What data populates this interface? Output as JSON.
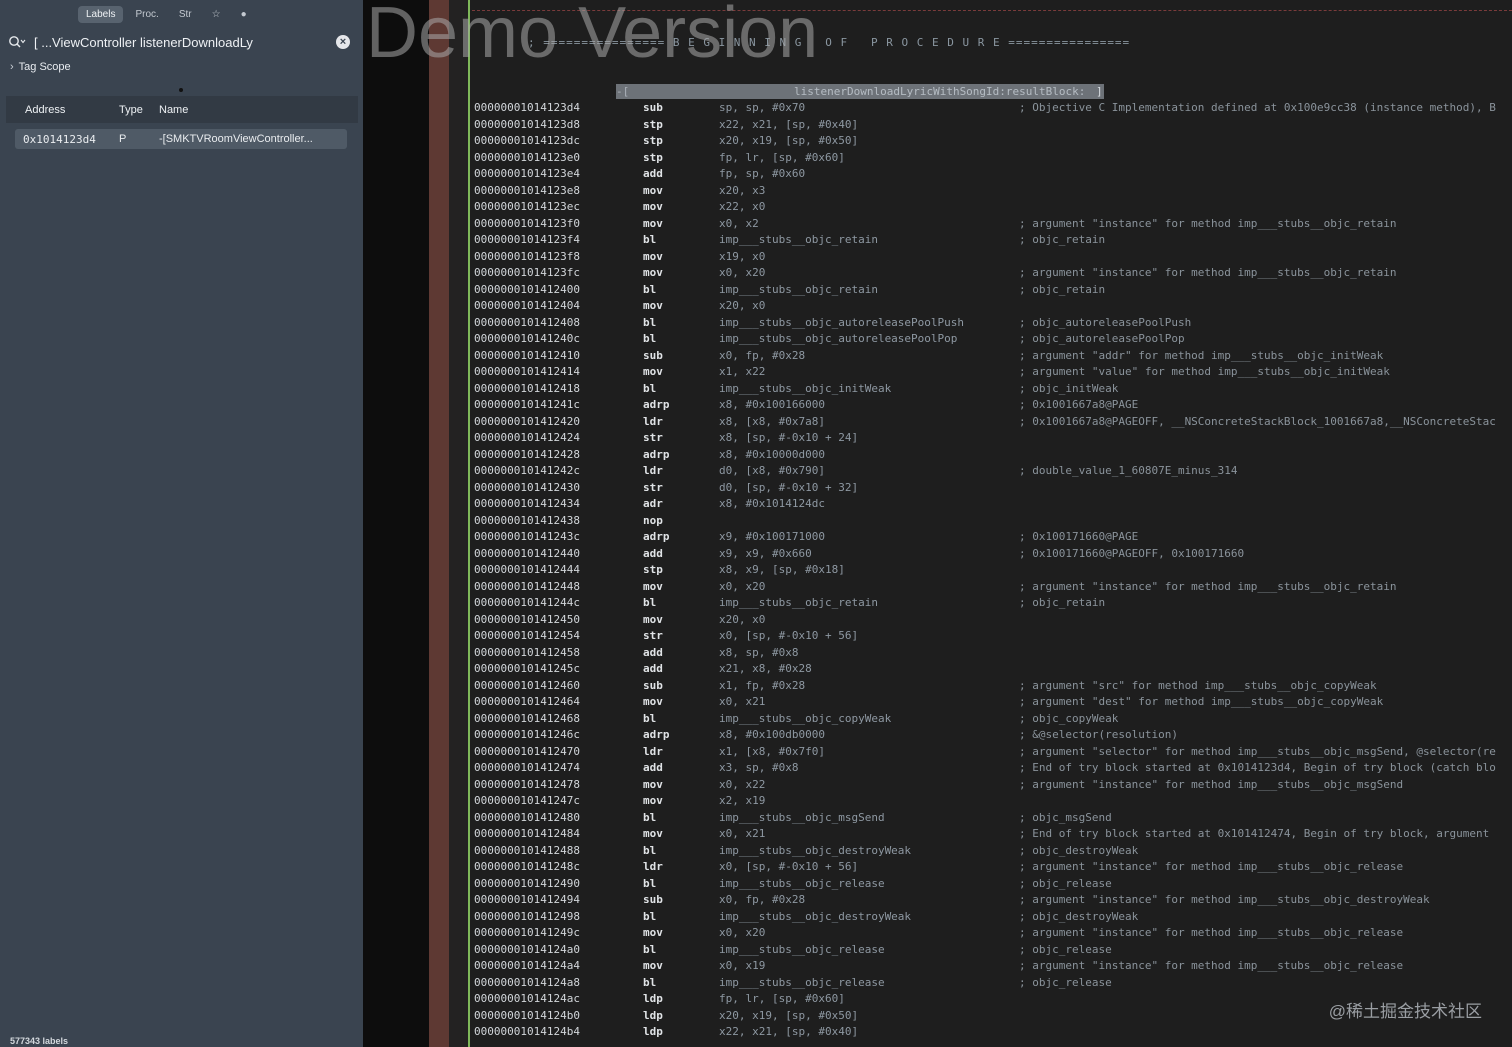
{
  "sidebar": {
    "tabs": [
      "Labels",
      "Proc.",
      "Str",
      "☆",
      "●"
    ],
    "search": {
      "value": "[ ...ViewController listenerDownloadLy"
    },
    "tag_scope": "Tag Scope",
    "columns": {
      "address": "Address",
      "type": "Type",
      "name": "Name"
    },
    "result": {
      "address": "0x1014123d4",
      "type": "P",
      "name": "-[SMKTVRoomViewController..."
    },
    "label_count": "577343 labels"
  },
  "code": {
    "watermark": "Demo Version",
    "banner": "; ================ B E G I N N I N G   O F   P R O C E D U R E ================",
    "procedure_label": "listenerDownloadLyricWithSongId:resultBlock:",
    "procedure_prefix": "-[",
    "procedure_suffix": "]:",
    "lines": [
      {
        "a": "00000001014123d4",
        "m": "sub",
        "o": "sp, sp, #0x70",
        "c": "; Objective C Implementation defined at 0x100e9cc38 (instance method), B"
      },
      {
        "a": "00000001014123d8",
        "m": "stp",
        "o": "x22, x21, [sp, #0x40]",
        "c": ""
      },
      {
        "a": "00000001014123dc",
        "m": "stp",
        "o": "x20, x19, [sp, #0x50]",
        "c": ""
      },
      {
        "a": "00000001014123e0",
        "m": "stp",
        "o": "fp, lr, [sp, #0x60]",
        "c": ""
      },
      {
        "a": "00000001014123e4",
        "m": "add",
        "o": "fp, sp, #0x60",
        "c": ""
      },
      {
        "a": "00000001014123e8",
        "m": "mov",
        "o": "x20, x3",
        "c": ""
      },
      {
        "a": "00000001014123ec",
        "m": "mov",
        "o": "x22, x0",
        "c": ""
      },
      {
        "a": "00000001014123f0",
        "m": "mov",
        "o": "x0, x2",
        "c": "; argument \"instance\" for method imp___stubs__objc_retain"
      },
      {
        "a": "00000001014123f4",
        "m": "bl",
        "o": "imp___stubs__objc_retain",
        "c": "; objc_retain"
      },
      {
        "a": "00000001014123f8",
        "m": "mov",
        "o": "x19, x0",
        "c": ""
      },
      {
        "a": "00000001014123fc",
        "m": "mov",
        "o": "x0, x20",
        "c": "; argument \"instance\" for method imp___stubs__objc_retain"
      },
      {
        "a": "0000000101412400",
        "m": "bl",
        "o": "imp___stubs__objc_retain",
        "c": "; objc_retain"
      },
      {
        "a": "0000000101412404",
        "m": "mov",
        "o": "x20, x0",
        "c": ""
      },
      {
        "a": "0000000101412408",
        "m": "bl",
        "o": "imp___stubs__objc_autoreleasePoolPush",
        "c": "; objc_autoreleasePoolPush"
      },
      {
        "a": "000000010141240c",
        "m": "bl",
        "o": "imp___stubs__objc_autoreleasePoolPop",
        "c": "; objc_autoreleasePoolPop"
      },
      {
        "a": "0000000101412410",
        "m": "sub",
        "o": "x0, fp, #0x28",
        "c": "; argument \"addr\" for method imp___stubs__objc_initWeak"
      },
      {
        "a": "0000000101412414",
        "m": "mov",
        "o": "x1, x22",
        "c": "; argument \"value\" for method imp___stubs__objc_initWeak"
      },
      {
        "a": "0000000101412418",
        "m": "bl",
        "o": "imp___stubs__objc_initWeak",
        "c": "; objc_initWeak"
      },
      {
        "a": "000000010141241c",
        "m": "adrp",
        "o": "x8, #0x100166000",
        "c": "; 0x1001667a8@PAGE"
      },
      {
        "a": "0000000101412420",
        "m": "ldr",
        "o": "x8, [x8, #0x7a8]",
        "c": "; 0x1001667a8@PAGEOFF, __NSConcreteStackBlock_1001667a8,__NSConcreteStac"
      },
      {
        "a": "0000000101412424",
        "m": "str",
        "o": "x8, [sp, #-0x10 + 24]",
        "c": ""
      },
      {
        "a": "0000000101412428",
        "m": "adrp",
        "o": "x8, #0x10000d000",
        "c": ""
      },
      {
        "a": "000000010141242c",
        "m": "ldr",
        "o": "d0, [x8, #0x790]",
        "c": "; double_value_1_60807E_minus_314"
      },
      {
        "a": "0000000101412430",
        "m": "str",
        "o": "d0, [sp, #-0x10 + 32]",
        "c": ""
      },
      {
        "a": "0000000101412434",
        "m": "adr",
        "o": "x8, #0x1014124dc",
        "c": ""
      },
      {
        "a": "0000000101412438",
        "m": "nop",
        "o": "",
        "c": ""
      },
      {
        "a": "000000010141243c",
        "m": "adrp",
        "o": "x9, #0x100171000",
        "c": "; 0x100171660@PAGE"
      },
      {
        "a": "0000000101412440",
        "m": "add",
        "o": "x9, x9, #0x660",
        "c": "; 0x100171660@PAGEOFF, 0x100171660"
      },
      {
        "a": "0000000101412444",
        "m": "stp",
        "o": "x8, x9, [sp, #0x18]",
        "c": ""
      },
      {
        "a": "0000000101412448",
        "m": "mov",
        "o": "x0, x20",
        "c": "; argument \"instance\" for method imp___stubs__objc_retain"
      },
      {
        "a": "000000010141244c",
        "m": "bl",
        "o": "imp___stubs__objc_retain",
        "c": "; objc_retain"
      },
      {
        "a": "0000000101412450",
        "m": "mov",
        "o": "x20, x0",
        "c": ""
      },
      {
        "a": "0000000101412454",
        "m": "str",
        "o": "x0, [sp, #-0x10 + 56]",
        "c": ""
      },
      {
        "a": "0000000101412458",
        "m": "add",
        "o": "x8, sp, #0x8",
        "c": ""
      },
      {
        "a": "000000010141245c",
        "m": "add",
        "o": "x21, x8, #0x28",
        "c": ""
      },
      {
        "a": "0000000101412460",
        "m": "sub",
        "o": "x1, fp, #0x28",
        "c": "; argument \"src\" for method imp___stubs__objc_copyWeak"
      },
      {
        "a": "0000000101412464",
        "m": "mov",
        "o": "x0, x21",
        "c": "; argument \"dest\" for method imp___stubs__objc_copyWeak"
      },
      {
        "a": "0000000101412468",
        "m": "bl",
        "o": "imp___stubs__objc_copyWeak",
        "c": "; objc_copyWeak"
      },
      {
        "a": "000000010141246c",
        "m": "adrp",
        "o": "x8, #0x100db0000",
        "c": "; &@selector(resolution)"
      },
      {
        "a": "0000000101412470",
        "m": "ldr",
        "o": "x1, [x8, #0x7f0]",
        "c": "; argument \"selector\" for method imp___stubs__objc_msgSend, @selector(re"
      },
      {
        "a": "0000000101412474",
        "m": "add",
        "o": "x3, sp, #0x8",
        "c": "; End of try block started at 0x1014123d4, Begin of try block (catch blo"
      },
      {
        "a": "0000000101412478",
        "m": "mov",
        "o": "x0, x22",
        "c": "; argument \"instance\" for method imp___stubs__objc_msgSend"
      },
      {
        "a": "000000010141247c",
        "m": "mov",
        "o": "x2, x19",
        "c": ""
      },
      {
        "a": "0000000101412480",
        "m": "bl",
        "o": "imp___stubs__objc_msgSend",
        "c": "; objc_msgSend"
      },
      {
        "a": "0000000101412484",
        "m": "mov",
        "o": "x0, x21",
        "c": "; End of try block started at 0x101412474, Begin of try block, argument"
      },
      {
        "a": "0000000101412488",
        "m": "bl",
        "o": "imp___stubs__objc_destroyWeak",
        "c": "; objc_destroyWeak"
      },
      {
        "a": "000000010141248c",
        "m": "ldr",
        "o": "x0, [sp, #-0x10 + 56]",
        "c": "; argument \"instance\" for method imp___stubs__objc_release"
      },
      {
        "a": "0000000101412490",
        "m": "bl",
        "o": "imp___stubs__objc_release",
        "c": "; objc_release"
      },
      {
        "a": "0000000101412494",
        "m": "sub",
        "o": "x0, fp, #0x28",
        "c": "; argument \"instance\" for method imp___stubs__objc_destroyWeak"
      },
      {
        "a": "0000000101412498",
        "m": "bl",
        "o": "imp___stubs__objc_destroyWeak",
        "c": "; objc_destroyWeak"
      },
      {
        "a": "000000010141249c",
        "m": "mov",
        "o": "x0, x20",
        "c": "; argument \"instance\" for method imp___stubs__objc_release"
      },
      {
        "a": "00000001014124a0",
        "m": "bl",
        "o": "imp___stubs__objc_release",
        "c": "; objc_release"
      },
      {
        "a": "00000001014124a4",
        "m": "mov",
        "o": "x0, x19",
        "c": "; argument \"instance\" for method imp___stubs__objc_release"
      },
      {
        "a": "00000001014124a8",
        "m": "bl",
        "o": "imp___stubs__objc_release",
        "c": "; objc_release"
      },
      {
        "a": "00000001014124ac",
        "m": "ldp",
        "o": "fp, lr, [sp, #0x60]",
        "c": ""
      },
      {
        "a": "00000001014124b0",
        "m": "ldp",
        "o": "x20, x19, [sp, #0x50]",
        "c": ""
      },
      {
        "a": "00000001014124b4",
        "m": "ldp",
        "o": "x22, x21, [sp, #0x40]",
        "c": ""
      }
    ]
  },
  "brand_watermark": "@稀土掘金技术社区"
}
